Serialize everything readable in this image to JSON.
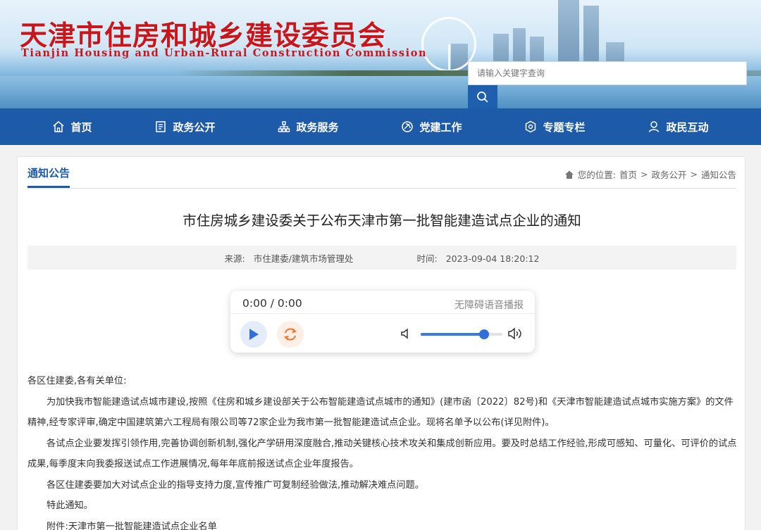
{
  "header": {
    "title_cn": "天津市住房和城乡建设委员会",
    "title_en": "Tianjin Housing and Urban-Rural Construction Commission",
    "search_placeholder": "请输入关键字查询"
  },
  "nav": {
    "items": [
      {
        "label": "首页",
        "icon": "home-icon"
      },
      {
        "label": "政务公开",
        "icon": "document-icon"
      },
      {
        "label": "政务服务",
        "icon": "org-chart-icon"
      },
      {
        "label": "党建工作",
        "icon": "party-icon"
      },
      {
        "label": "专题专栏",
        "icon": "badge-icon"
      },
      {
        "label": "政民互动",
        "icon": "user-icon"
      }
    ]
  },
  "section": {
    "tab": "通知公告",
    "breadcrumb_prefix": "您的位置:",
    "crumbs": [
      "首页",
      "政务公开",
      "通知公告"
    ],
    "separator": ">"
  },
  "article": {
    "title": "市住房城乡建设委关于公布天津市第一批智能建造试点企业的通知",
    "source_label": "来源:",
    "source": "市住建委/建筑市场管理处",
    "time_label": "时间:",
    "time": "2023-09-04 18:20:12",
    "greeting": "各区住建委,各有关单位:",
    "paragraphs": [
      "为加快我市智能建造试点城市建设,按照《住房和城乡建设部关于公布智能建造试点城市的通知》(建市函〔2022〕82号)和《天津市智能建造试点城市实施方案》的文件精神,经专家评审,确定中国建筑第六工程局有限公司等72家企业为我市第一批智能建造试点企业。现将名单予以公布(详见附件)。",
      "各试点企业要发挥引领作用,完善协调创新机制,强化产学研用深度融合,推动关键核心技术攻关和集成创新应用。要及时总结工作经验,形成可感知、可量化、可评价的试点成果,每季度末向我委报送试点工作进展情况,每年年底前报送试点企业年度报告。",
      "各区住建委要加大对试点企业的指导支持力度,宣传推广可复制经验做法,推动解决难点问题。",
      "特此通知。",
      "附件:天津市第一批智能建造试点企业名单"
    ]
  },
  "audio": {
    "time": "0:00 / 0:00",
    "caption": "无障碍语音播报",
    "volume": 0.78,
    "accent": "#2f6fd6"
  },
  "colors": {
    "nav_bg": "#1d5aa8",
    "title_red": "#c8161d"
  }
}
